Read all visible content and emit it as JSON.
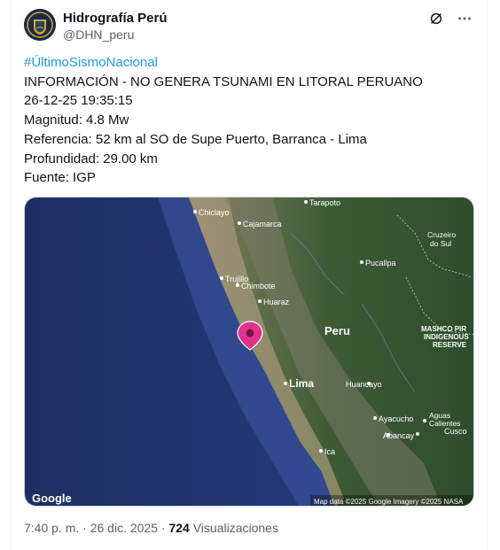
{
  "account": {
    "name": "Hidrografía Perú",
    "handle": "@DHN_peru"
  },
  "tweet": {
    "hashtag": "#ÚltimoSismoNacional",
    "lines": [
      "INFORMACIÓN - NO GENERA TSUNAMI EN LITORAL PERUANO",
      "26-12-25 19:35:15",
      "Magnitud: 4.8 Mw",
      "Referencia: 52 km al SO de Supe Puerto, Barranca - Lima",
      "Profundidad: 29.00 km",
      "Fuente: IGP"
    ]
  },
  "map": {
    "labels": {
      "chiclayo": "Chiclayo",
      "cajamarca": "Cajamarca",
      "tarapoto": "Tarapoto",
      "trujillo": "Trujillo",
      "cruzeiro": "Cruzeiro do Sul",
      "pucallpa": "Pucallpa",
      "chimbote": "Chimbote",
      "huaraz": "Huaraz",
      "peru": "Peru",
      "mashco": "MASHCO PIRO INDIGENOUS RESERVE",
      "mashco_l1": "MASHCO PIR",
      "mashco_l2": "INDIGENOUS",
      "mashco_l3": "RESERVE",
      "lima": "Lima",
      "huancayo": "Huancayo",
      "ayacucho": "Ayacucho",
      "aguas": "Aguas Calientes",
      "aguas_l1": "Aguas",
      "aguas_l2": "Calientes",
      "cusco": "Cusco",
      "abancay": "Abancay",
      "ica": "Ica"
    },
    "google_logo": "Google",
    "attribution": "Map data ©2025 Google Imagery ©2025 NASA",
    "pin_color": "#e0338a"
  },
  "footer": {
    "time": "7:40 p. m.",
    "separator": " · ",
    "date": "26 dic. 2025",
    "views_count": "724",
    "views_label": "Visualizaciones"
  },
  "icons": [
    "grok-icon",
    "more-options-icon",
    "map-pin-icon"
  ]
}
